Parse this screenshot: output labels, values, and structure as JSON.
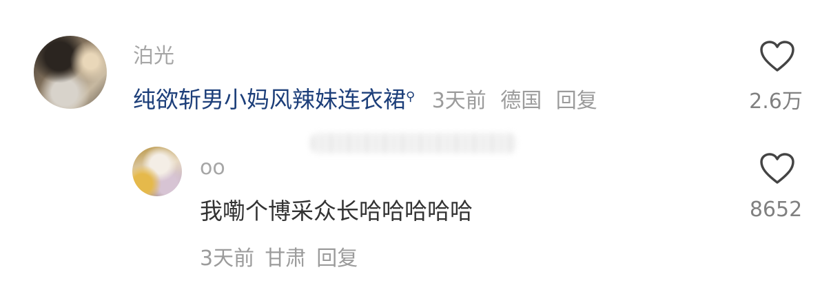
{
  "comment1": {
    "username": "泊光",
    "link_text": "纯欲斩男小妈风辣妹连衣裙",
    "time": "3天前",
    "location": "德国",
    "reply_label": "回复",
    "likes": "2.6万"
  },
  "comment2": {
    "username": "oo",
    "content": "我嘞个博采众长哈哈哈哈哈",
    "time": "3天前",
    "location": "甘肃",
    "reply_label": "回复",
    "likes": "8652"
  },
  "icons": {
    "heart": "heart-icon",
    "search": "search-icon"
  },
  "colors": {
    "link": "#1d3f7a",
    "meta": "#9b9b9b"
  }
}
